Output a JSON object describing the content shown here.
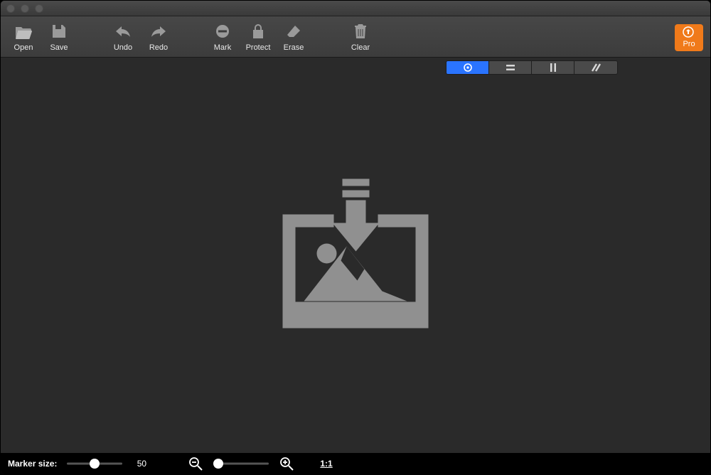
{
  "toolbar": {
    "open": "Open",
    "save": "Save",
    "undo": "Undo",
    "redo": "Redo",
    "mark": "Mark",
    "protect": "Protect",
    "erase": "Erase",
    "clear": "Clear",
    "pro": "Pro"
  },
  "view_modes": {
    "selected_index": 0,
    "icons": [
      "circle-target-icon",
      "equals-icon",
      "pause-bars-icon",
      "diagonal-lines-icon"
    ]
  },
  "status": {
    "marker_label": "Marker size:",
    "marker_value": "50",
    "marker_slider_position": 0.5,
    "zoom_slider_position": 0.08,
    "actual_size_label": "1:1"
  },
  "colors": {
    "accent": "#2a74ff",
    "pro": "#f07a1a",
    "icon_gray": "#9a9a9a",
    "icon_light": "#d8d8d8"
  }
}
